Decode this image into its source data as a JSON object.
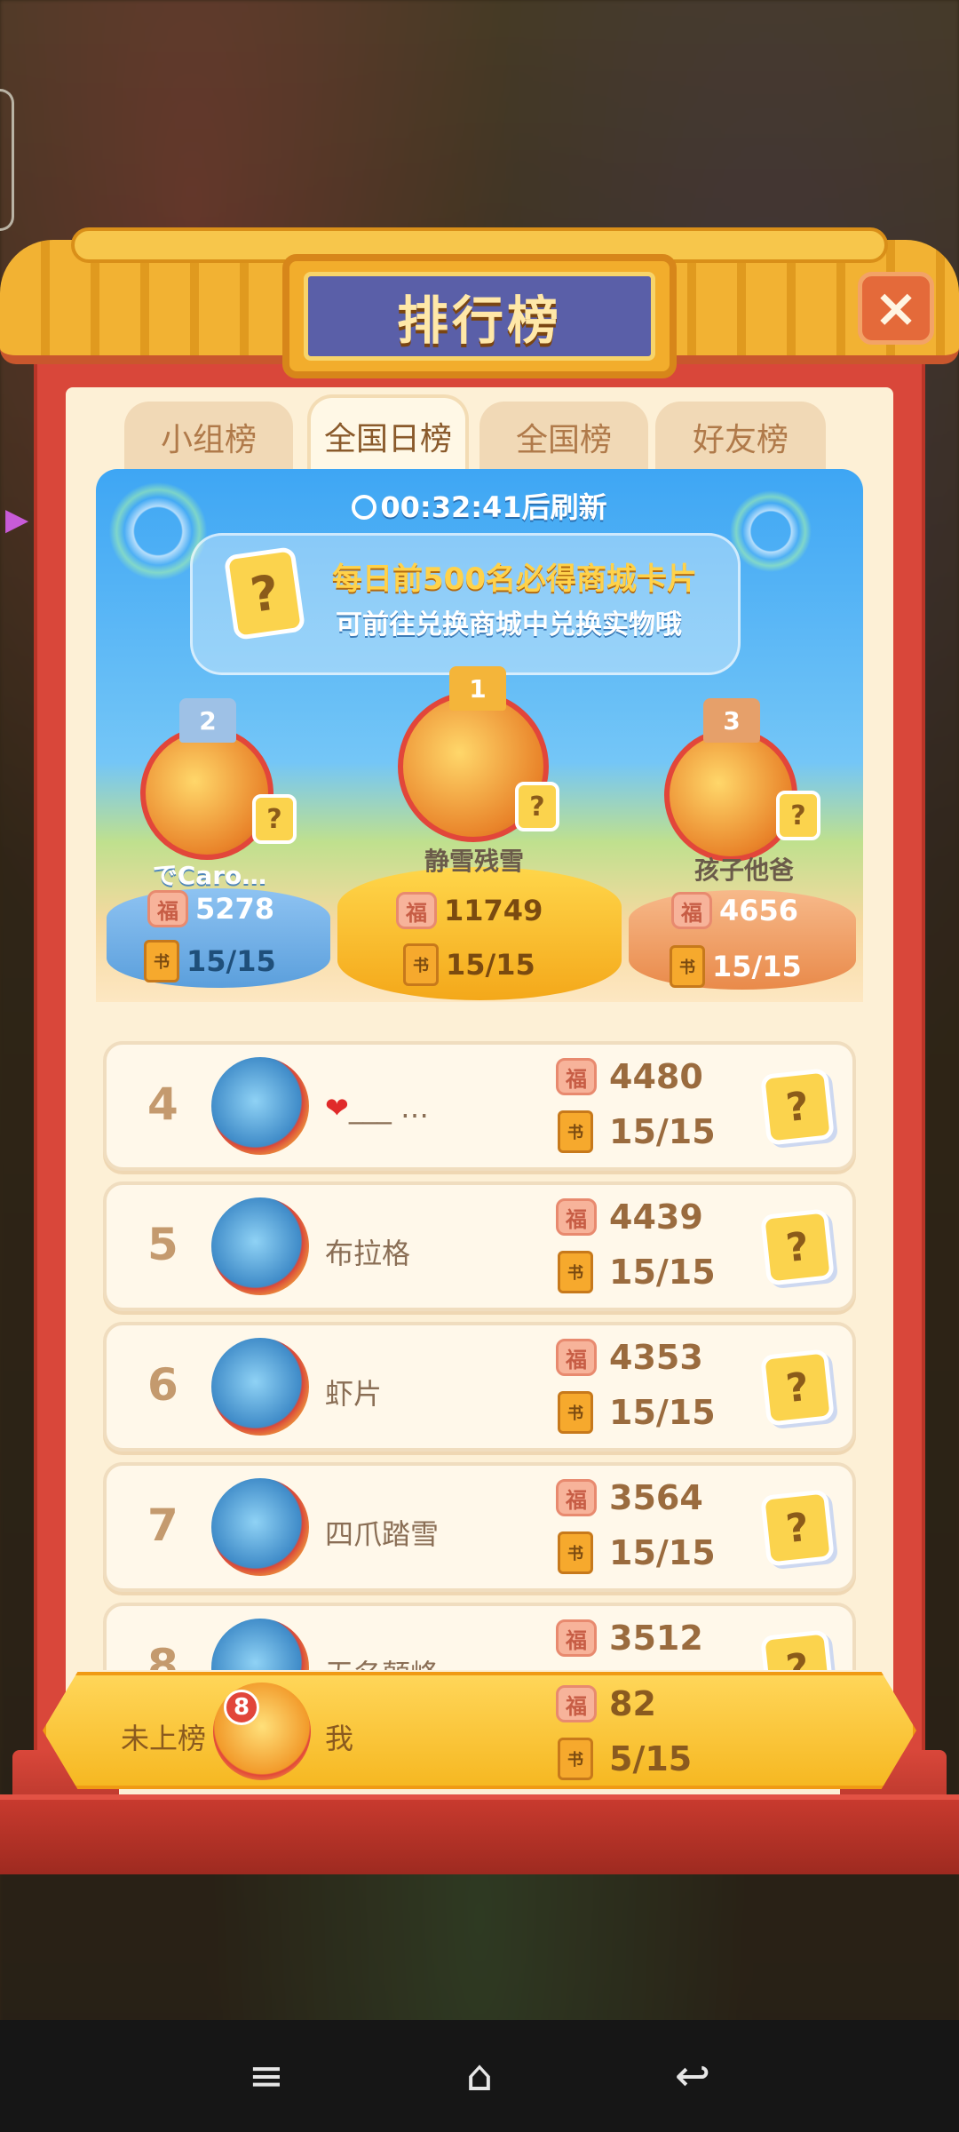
{
  "title": "排行榜",
  "close_label": "×",
  "tabs": [
    {
      "label": "小组榜",
      "active": false
    },
    {
      "label": "全国日榜",
      "active": true
    },
    {
      "label": "全国榜",
      "active": false
    },
    {
      "label": "好友榜",
      "active": false
    }
  ],
  "refresh_text": "00:32:41后刷新",
  "banner": {
    "line1": "每日前500名必得商城卡片",
    "line2": "可前往兑换商城中兑换实物哦",
    "card_symbol": "?"
  },
  "podium": {
    "first": {
      "rank": "1",
      "name": "静雪残雪",
      "score": "11749",
      "progress": "15/15"
    },
    "second": {
      "rank": "2",
      "name": "でCaro…",
      "score": "5278",
      "progress": "15/15"
    },
    "third": {
      "rank": "3",
      "name": "孩子他爸",
      "score": "4656",
      "progress": "15/15"
    }
  },
  "rows": [
    {
      "rank": "4",
      "name": "___ …",
      "heart": "❤",
      "score": "4480",
      "progress": "15/15"
    },
    {
      "rank": "5",
      "name": "布拉格",
      "heart": "",
      "score": "4439",
      "progress": "15/15"
    },
    {
      "rank": "6",
      "name": "虾片",
      "heart": "",
      "score": "4353",
      "progress": "15/15"
    },
    {
      "rank": "7",
      "name": "四爪踏雪",
      "heart": "",
      "score": "3564",
      "progress": "15/15"
    },
    {
      "rank": "8",
      "name": "无名颠峰",
      "heart": "",
      "score": "3512",
      "progress": ""
    }
  ],
  "me": {
    "rank_label": "未上榜",
    "badge": "8",
    "name": "我",
    "score": "82",
    "progress": "5/15"
  },
  "icons": {
    "fu": "福",
    "book": "书",
    "question": "?"
  },
  "nav": {
    "menu": "≡",
    "home": "⌂",
    "back": "↩"
  }
}
